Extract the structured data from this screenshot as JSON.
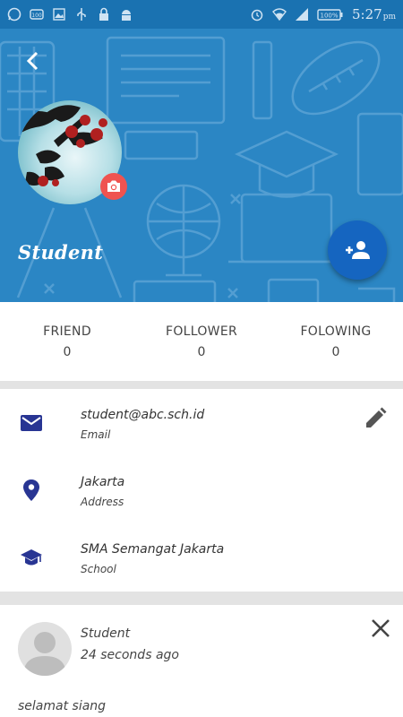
{
  "status_bar": {
    "time": "5:27",
    "ampm": "pm",
    "battery": "100%"
  },
  "profile": {
    "name": "Student"
  },
  "stats": [
    {
      "label": "FRIEND",
      "value": "0"
    },
    {
      "label": "FOLLOWER",
      "value": "0"
    },
    {
      "label": "FOLOWING",
      "value": "0"
    }
  ],
  "info": {
    "email": {
      "value": "student@abc.sch.id",
      "label": "Email"
    },
    "address": {
      "value": "Jakarta",
      "label": "Address"
    },
    "school": {
      "value": "SMA Semangat Jakarta",
      "label": "School"
    }
  },
  "post": {
    "author": "Student",
    "time": "24 seconds ago",
    "text": "selamat siang"
  },
  "colors": {
    "status_bar": "#1a72b1",
    "header": "#2b86c4",
    "fab": "#1565c0",
    "camera_button": "#ef5350",
    "info_icon": "#283593"
  }
}
